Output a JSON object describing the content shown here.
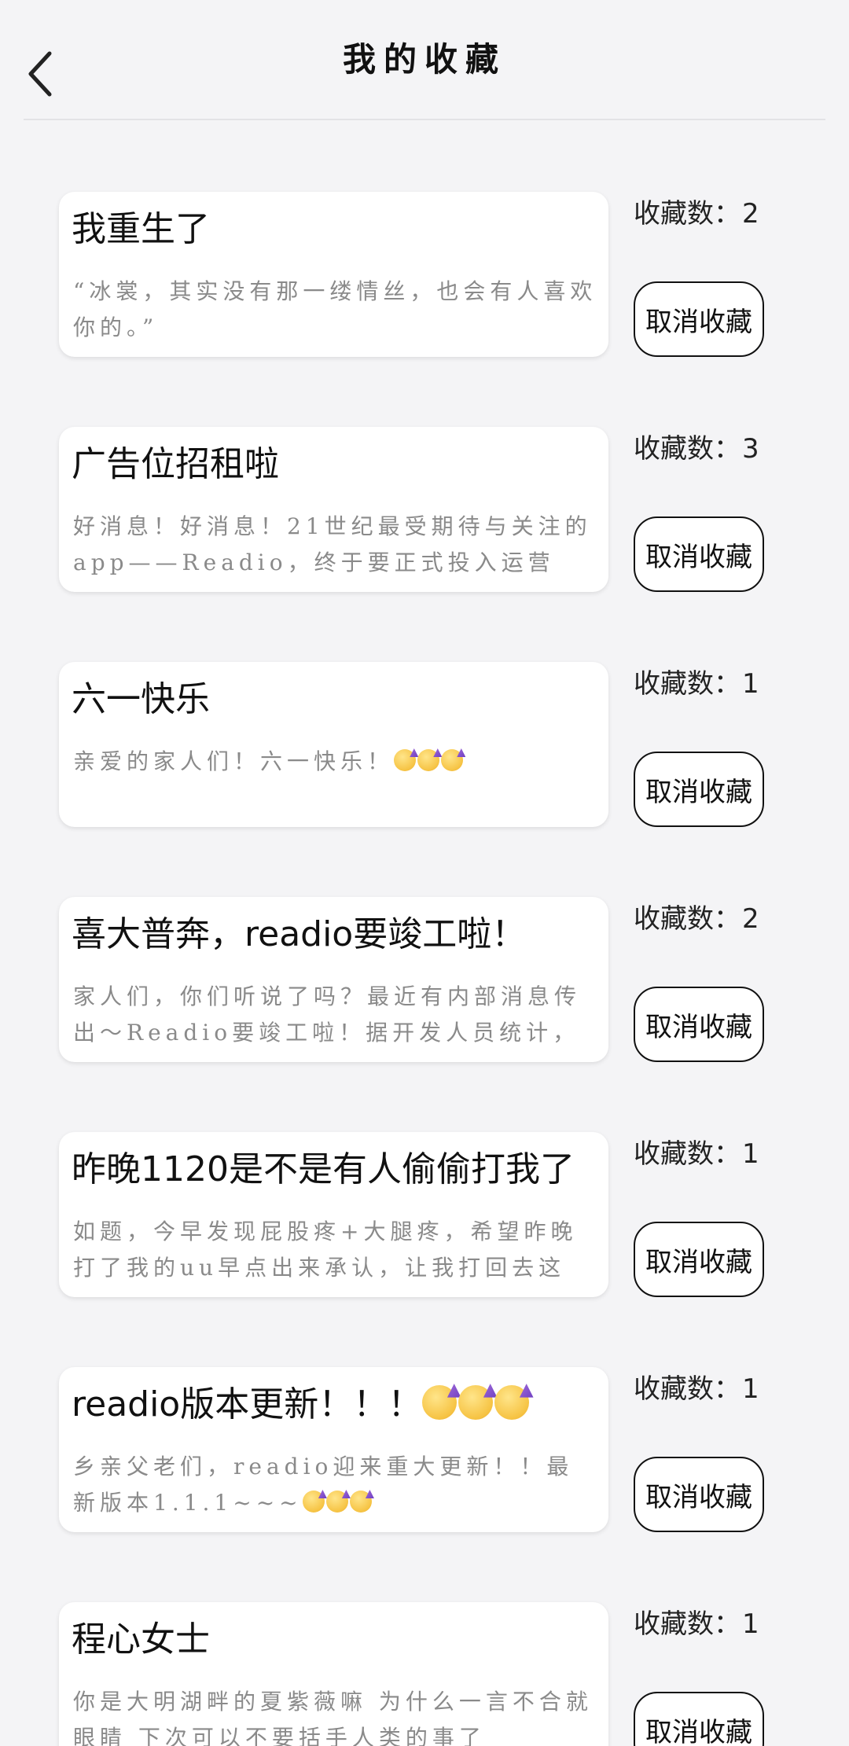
{
  "header": {
    "title": "我的收藏",
    "back_icon": "chevron-left-icon"
  },
  "favorites": [
    {
      "title": "我重生了",
      "excerpt": "“冰裳，其实没有那一缕情丝，也会有人喜欢你的。”",
      "count_label": "收藏数：",
      "count": "2",
      "button_label": "取消收藏"
    },
    {
      "title": "广告位招租啦",
      "excerpt": "好消息！好消息！21世纪最受期待与关注的app——Readio，终于要正式投入运营",
      "count_label": "收藏数：",
      "count": "3",
      "button_label": "取消收藏"
    },
    {
      "title": "六一快乐",
      "excerpt": "亲爱的家人们！六一快乐！",
      "excerpt_emoji_count": 3,
      "count_label": "收藏数：",
      "count": "1",
      "button_label": "取消收藏"
    },
    {
      "title": "喜大普奔，readio要竣工啦！",
      "excerpt": "家人们，你们听说了吗？最近有内部消息传出～Readio要竣工啦！据开发人员统计，",
      "count_label": "收藏数：",
      "count": "2",
      "button_label": "取消收藏"
    },
    {
      "title": "昨晚1120是不是有人偷偷打我了",
      "excerpt": "如题，今早发现屁股疼+大腿疼，希望昨晚打了我的uu早点出来承认，让我打回去这",
      "count_label": "收藏数：",
      "count": "1",
      "button_label": "取消收藏"
    },
    {
      "title": "readio版本更新！！！",
      "title_emoji_count": 3,
      "excerpt": "乡亲父老们，readio迎来重大更新！！最新版本1.1.1~~~",
      "excerpt_emoji_count": 3,
      "count_label": "收藏数：",
      "count": "1",
      "button_label": "取消收藏"
    },
    {
      "title": "程心女士",
      "excerpt": "你是大明湖畔的夏紫薇嘛 为什么一言不合就眼睛 下次可以不要括手人类的事了",
      "count_label": "收藏数：",
      "count": "1",
      "button_label": "取消收藏"
    }
  ]
}
